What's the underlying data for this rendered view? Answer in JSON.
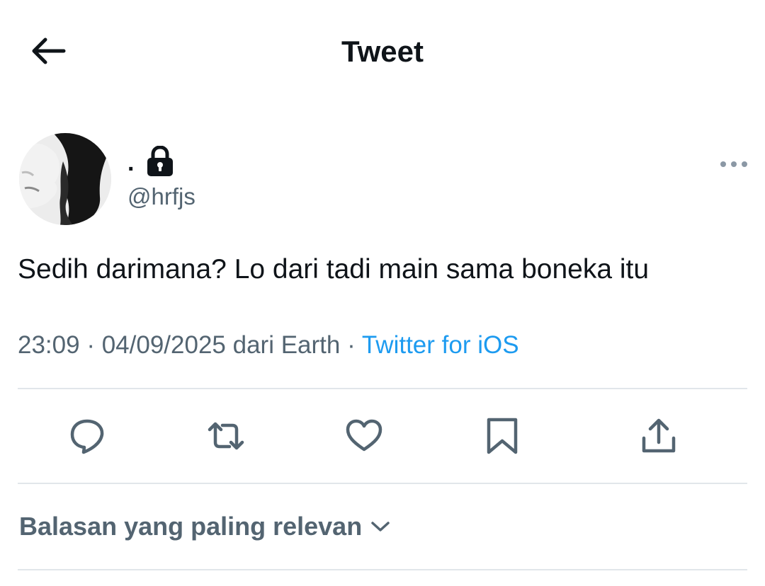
{
  "header": {
    "title": "Tweet",
    "back_icon": "arrow-left-icon"
  },
  "author": {
    "display_name": ".",
    "handle": "@hrfjs",
    "protected": true,
    "lock_icon": "lock-icon",
    "more_icon": "more-horizontal-icon"
  },
  "tweet": {
    "text": "Sedih darimana? Lo dari tadi main sama boneka itu",
    "time": "23:09",
    "sep1": "·",
    "date_location": "04/09/2025 dari Earth",
    "sep2": "·",
    "source": "Twitter for iOS"
  },
  "actions": [
    {
      "icon": "reply-icon"
    },
    {
      "icon": "retweet-icon"
    },
    {
      "icon": "like-icon"
    },
    {
      "icon": "bookmark-icon"
    },
    {
      "icon": "share-icon"
    }
  ],
  "replies_sort": {
    "label": "Balasan yang paling relevan",
    "icon": "chevron-down-icon"
  },
  "colors": {
    "text_primary": "#0f1419",
    "text_secondary": "#536471",
    "link": "#1d9bf0",
    "divider": "#e1e6ea"
  }
}
